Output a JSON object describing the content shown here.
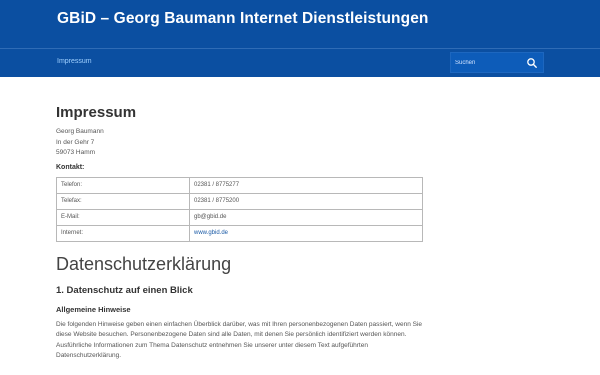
{
  "header": {
    "site_title": "GBiD – Georg Baumann Internet Dienstleistungen"
  },
  "nav": {
    "items": [
      {
        "label": "Impressum"
      }
    ]
  },
  "search": {
    "placeholder": "Suchen",
    "icon": "search-icon"
  },
  "colors": {
    "header_bg": "#0b4fa1",
    "nav_link": "#9fd0ff",
    "link": "#1a5aa6"
  },
  "page": {
    "title": "Impressum",
    "address": [
      "Georg Baumann",
      "In der Gehr 7",
      "59073 Hamm"
    ],
    "contact_heading": "Kontakt:",
    "contact_rows": [
      {
        "label": "Telefon:",
        "value": "02381 / 8775277"
      },
      {
        "label": "Telefax:",
        "value": "02381 / 8775200"
      },
      {
        "label": "E-Mail:",
        "value": "gb@gbid.de"
      },
      {
        "label": "Internet:",
        "value": "www.gbid.de"
      }
    ],
    "privacy_title": "Datenschutzerklärung",
    "section1_title": "1. Datenschutz auf einen Blick",
    "section1_sub": "Allgemeine Hinweise",
    "section1_text": "Die folgenden Hinweise geben einen einfachen Überblick darüber, was mit Ihren personenbezogenen Daten passiert, wenn Sie diese Website besuchen. Personenbezogene Daten sind alle Daten, mit denen Sie persönlich identifiziert werden können. Ausführliche Informationen zum Thema Datenschutz entnehmen Sie unserer unter diesem Text aufgeführten Datenschutzerklärung."
  }
}
